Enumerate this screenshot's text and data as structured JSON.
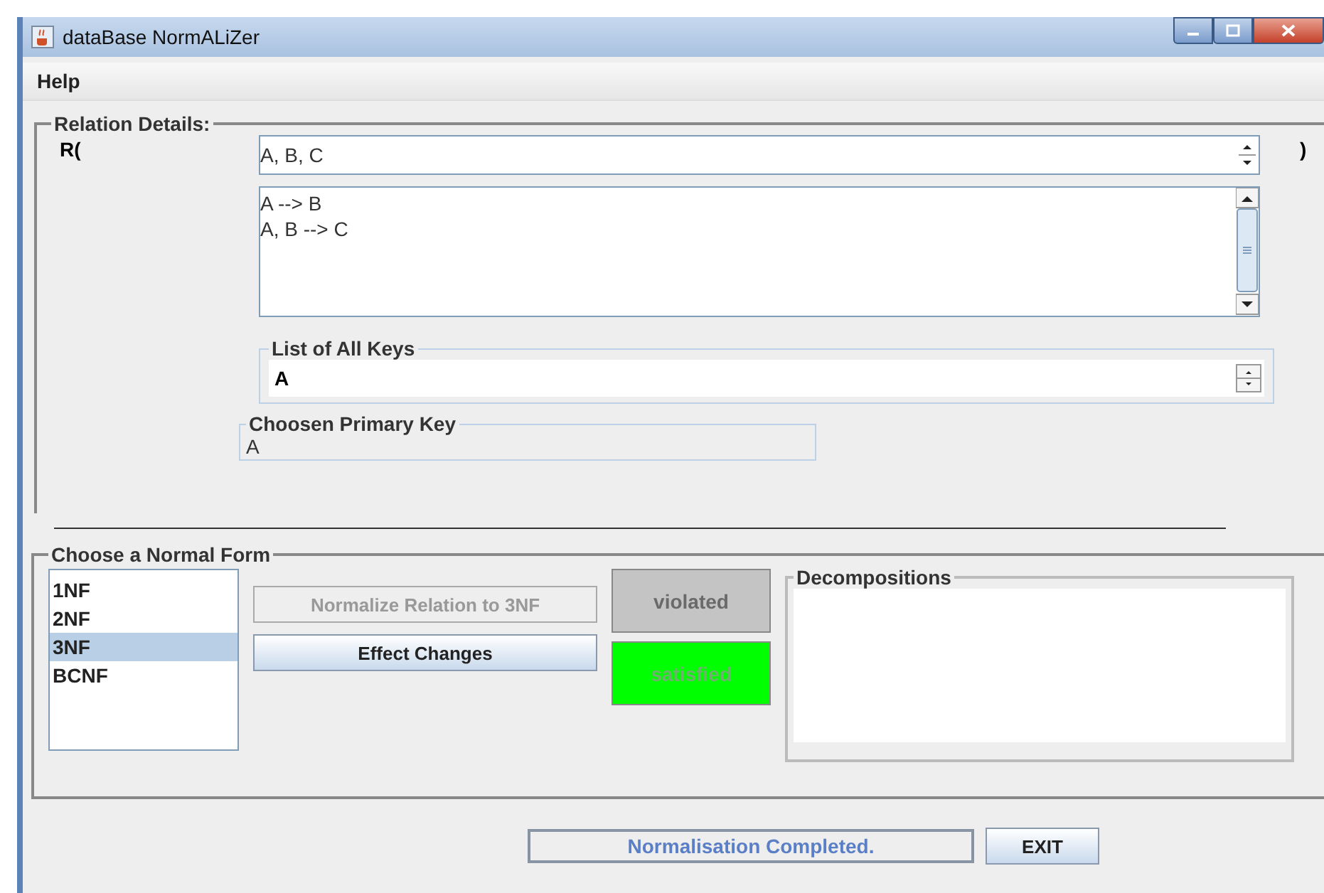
{
  "window": {
    "title": "dataBase NormALiZer"
  },
  "menu": [
    "Help"
  ],
  "relation_details": {
    "title": "Relation Details:",
    "prefix": "R(",
    "attributes": "A, B, C",
    "suffix": ")",
    "dependencies": [
      "A --> B",
      "A, B --> C"
    ],
    "keys": {
      "title": "List of All Keys",
      "value": "A"
    },
    "primary_key": {
      "title": "Choosen Primary Key",
      "value": "A"
    }
  },
  "normal_form": {
    "title": "Choose a Normal Form",
    "forms": [
      {
        "label": "1NF",
        "selected": false
      },
      {
        "label": "2NF",
        "selected": false
      },
      {
        "label": "3NF",
        "selected": true
      },
      {
        "label": "BCNF",
        "selected": false
      }
    ],
    "buttons": [
      {
        "label": "Normalize Relation to 3NF",
        "disabled": true
      },
      {
        "label": "Effect Changes",
        "disabled": false
      }
    ],
    "indicators": [
      {
        "label": "violated",
        "on": false
      },
      {
        "label": "satisfied",
        "on": true
      }
    ],
    "decompositions": {
      "title": "Decompositions"
    }
  },
  "status": "Normalisation Completed.",
  "exit": "EXIT"
}
